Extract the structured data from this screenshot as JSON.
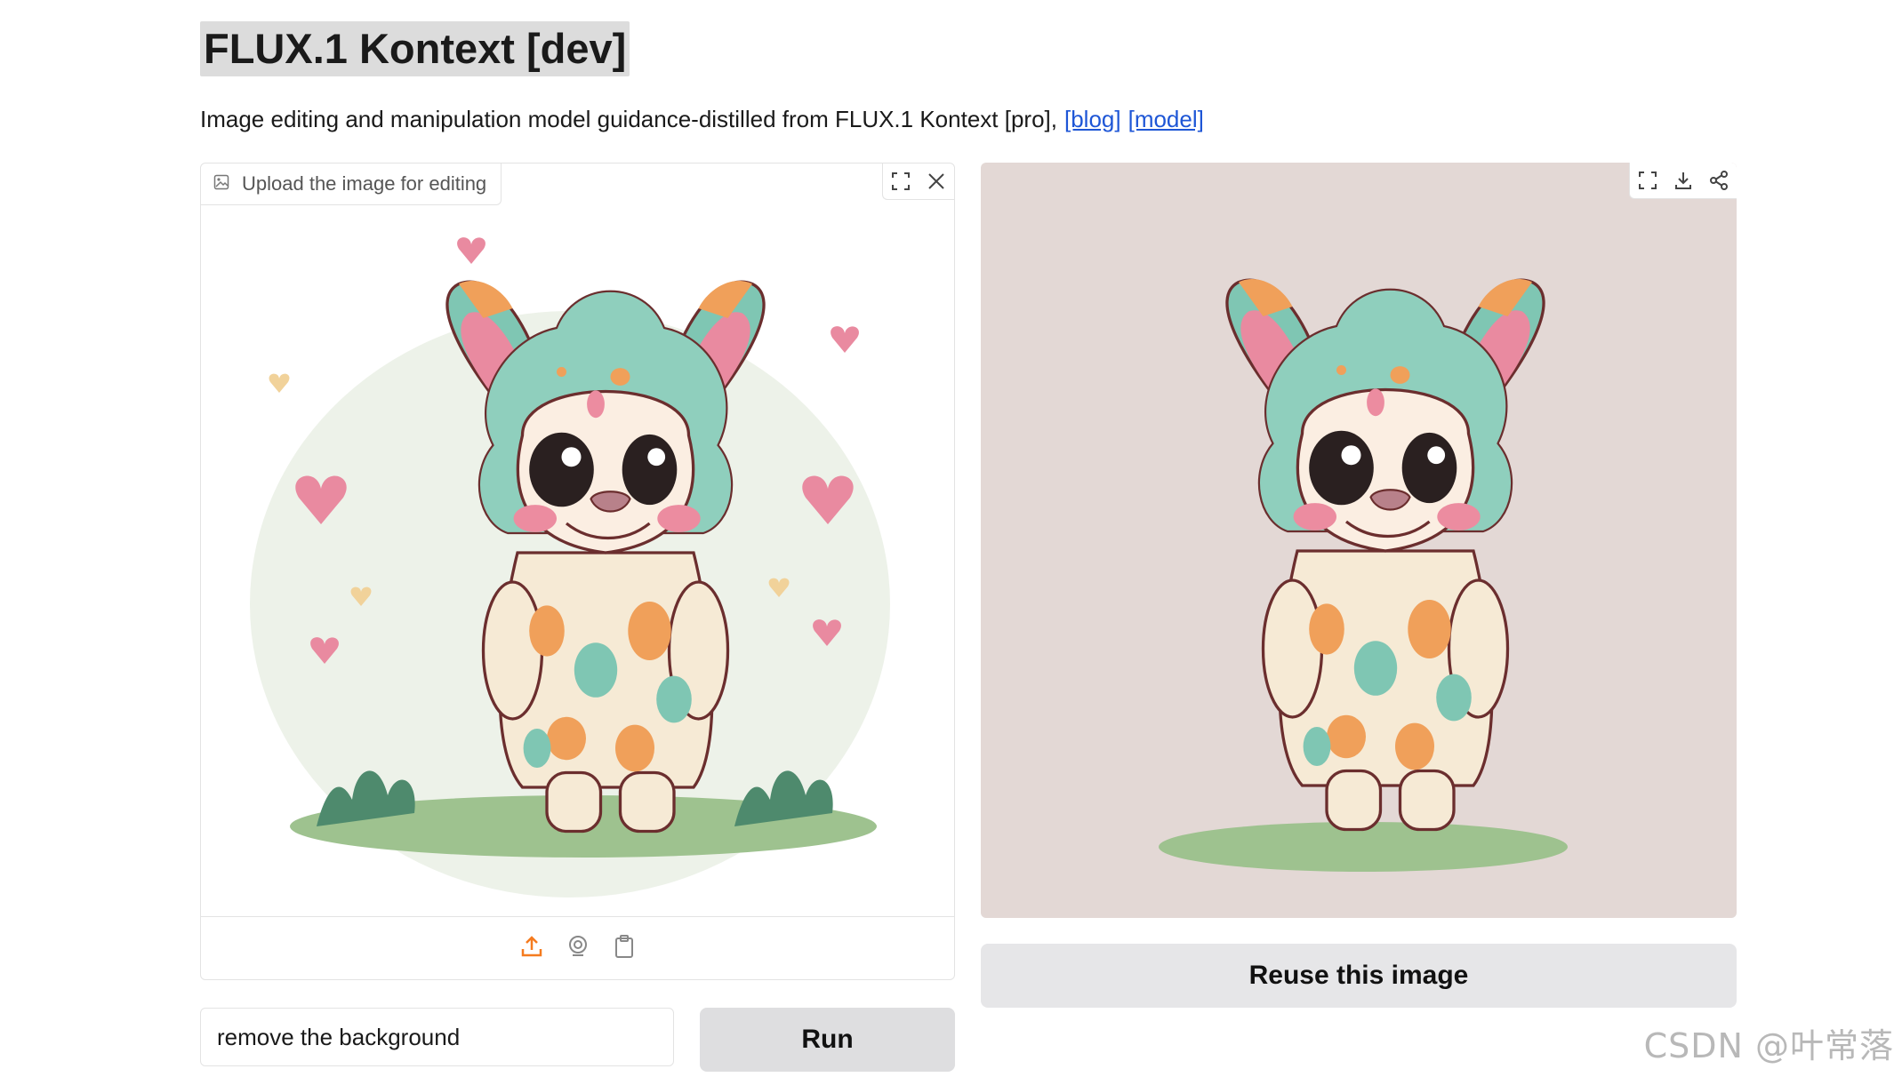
{
  "header": {
    "title": "FLUX.1 Kontext [dev]",
    "description": "Image editing and manipulation model guidance-distilled from FLUX.1 Kontext [pro],",
    "link_blog": "[blog]",
    "link_model": "[model]"
  },
  "input_panel": {
    "label": "Upload the image for editing",
    "icon": "image-icon",
    "tools": [
      "fullscreen-icon",
      "close-icon"
    ],
    "source_icons": [
      "upload-icon",
      "webcam-icon",
      "clipboard-icon"
    ]
  },
  "output_panel": {
    "tools": [
      "fullscreen-icon",
      "download-icon",
      "share-icon"
    ],
    "reuse_label": "Reuse this image"
  },
  "prompt": {
    "value": "remove the background"
  },
  "run_label": "Run",
  "watermark": "CSDN @叶常落",
  "colors": {
    "link": "#1e56d6",
    "upload_accent": "#f57b1f",
    "result_bg": "#e3d8d5",
    "button_bg": "#e6e6e8"
  }
}
